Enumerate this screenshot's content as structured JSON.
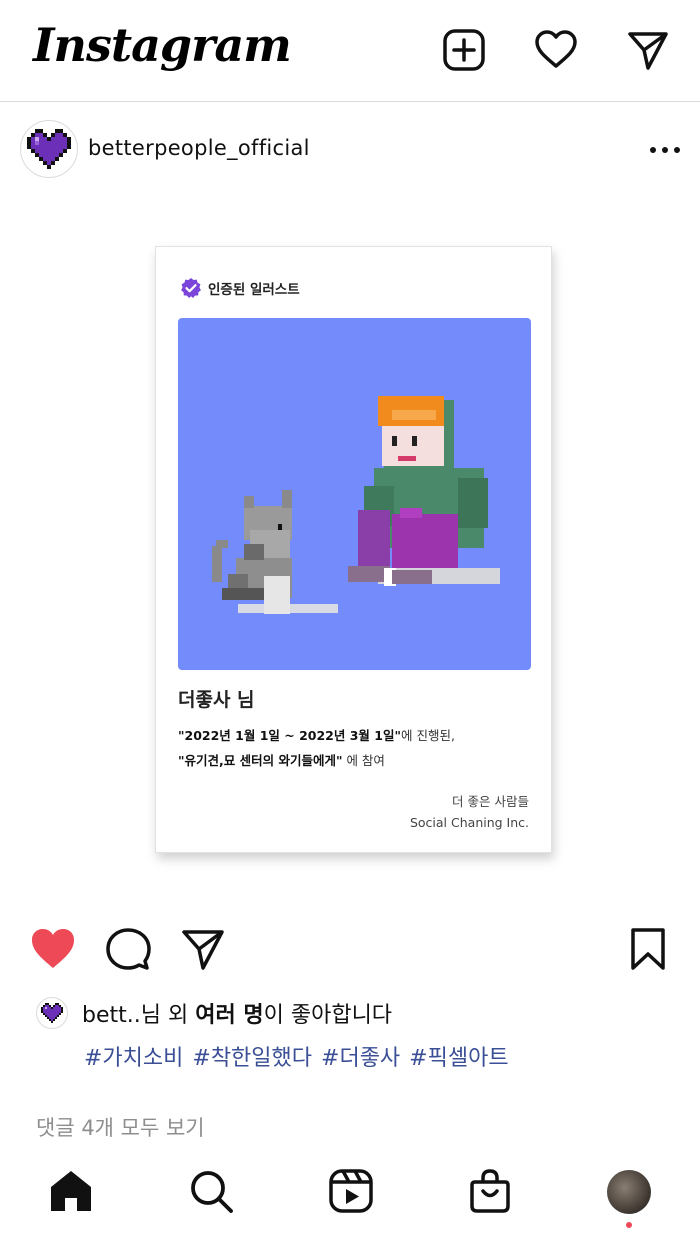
{
  "header": {
    "logo": "Instagram",
    "icons": [
      "add-post-icon",
      "heart-icon",
      "direct-message-icon"
    ]
  },
  "post": {
    "username": "betterpeople_official",
    "avatar_icon": "purple-pixel-heart-icon",
    "more_icon": "more-options-icon"
  },
  "certificate": {
    "badge": "인증된 일러스트",
    "badge_color": "#7a45d8",
    "art_background": "#738bfb",
    "name": "더좋사 님",
    "period": "\"2022년 1월 1일 ~ 2022년 3월 1일\"",
    "period_suffix": "에 진행된,",
    "campaign": "\"유기견,묘 센터의 와기들에게\"",
    "campaign_suffix": " 에 참여",
    "org_korean": "더 좋은 사람들",
    "org_english": "Social Chaning Inc."
  },
  "actions": {
    "like_icon": "heart-filled-icon",
    "like_color": "#ed4956",
    "comment_icon": "comment-icon",
    "share_icon": "share-icon",
    "save_icon": "bookmark-icon"
  },
  "likes": {
    "prefix": "bett..",
    "middle": "님 외 ",
    "bold": "여러 명",
    "suffix": "이 좋아합니다"
  },
  "hashtags": "#가치소비 #착한일했다 #더좋사 #픽셀아트",
  "comments_link": "댓글 4개 모두 보기",
  "nav": {
    "items": [
      "home-icon",
      "search-icon",
      "reels-icon",
      "shop-icon",
      "profile-avatar"
    ],
    "notification_color": "#ed4956"
  }
}
